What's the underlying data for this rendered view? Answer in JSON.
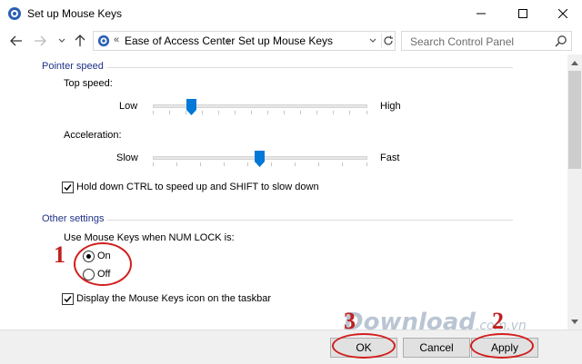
{
  "window": {
    "title": "Set up Mouse Keys",
    "minimize_icon": "minimize-icon",
    "maximize_icon": "maximize-icon",
    "close_icon": "close-icon"
  },
  "address_bar": {
    "separator": "«",
    "breadcrumbs": [
      "Ease of Access Center",
      "Set up Mouse Keys"
    ],
    "search_placeholder": "Search Control Panel"
  },
  "pointer_speed": {
    "title": "Pointer speed",
    "top_speed": {
      "label": "Top speed:",
      "min_label": "Low",
      "max_label": "High",
      "level": 0.17
    },
    "acceleration": {
      "label": "Acceleration:",
      "min_label": "Slow",
      "max_label": "Fast",
      "level": 0.5
    },
    "hold_ctrl": {
      "label": "Hold down CTRL to speed up and SHIFT to slow down",
      "checked": true
    }
  },
  "other_settings": {
    "title": "Other settings",
    "numlock_label": "Use Mouse Keys when NUM LOCK is:",
    "options": [
      {
        "label": "On",
        "selected": true
      },
      {
        "label": "Off",
        "selected": false
      }
    ],
    "display_icon": {
      "label": "Display the Mouse Keys icon on the taskbar",
      "checked": true
    }
  },
  "buttons": {
    "ok": "OK",
    "cancel": "Cancel",
    "apply": "Apply"
  },
  "annotations": {
    "step1": "1",
    "step2": "2",
    "step3": "3"
  },
  "watermark": {
    "text": "Download",
    "suffix": ".com.vn"
  },
  "colors": {
    "section_title": "#1e3287",
    "slider_thumb": "#0078d7",
    "annotation": "#d21e1e"
  }
}
